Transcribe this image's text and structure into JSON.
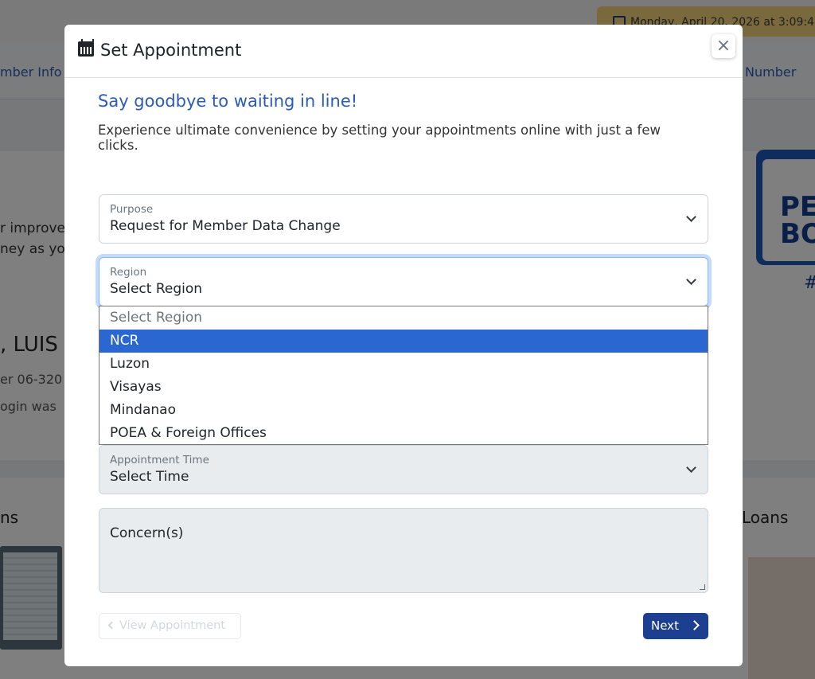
{
  "background": {
    "datetime": "Monday, April 20, 2026 at 3:09:4",
    "nav_left": "mber Info",
    "nav_right": "Number",
    "hero_line1": "r improved",
    "hero_line2": "ney as you",
    "member_name": ", LUIS",
    "member_number": "er 06-320",
    "login_text": "ogin was",
    "banner_text": "PE BO",
    "banner_hash": "#",
    "section_left": "ns",
    "section_right": "Loans"
  },
  "modal": {
    "title": "Set Appointment",
    "close_label": "×",
    "headline": "Say goodbye to waiting in line!",
    "subtext": "Experience ultimate convenience by setting your appointments online with just a few clicks.",
    "purpose": {
      "label": "Purpose",
      "value": "Request for Member Data Change"
    },
    "region": {
      "label": "Region",
      "value": "Select Region",
      "options": [
        "Select Region",
        "NCR",
        "Luzon",
        "Visayas",
        "Mindanao",
        "POEA & Foreign Offices"
      ],
      "highlighted": "NCR"
    },
    "appointment_time": {
      "label": "Appointment Time",
      "value": "Select Time"
    },
    "concerns": {
      "placeholder": "Concern(s)"
    },
    "view_appointment_label": "View Appointment",
    "next_label": "Next"
  },
  "colors": {
    "accent": "#1d3f8f",
    "headline": "#2b5bb5",
    "option_highlight": "#2a67d1"
  }
}
